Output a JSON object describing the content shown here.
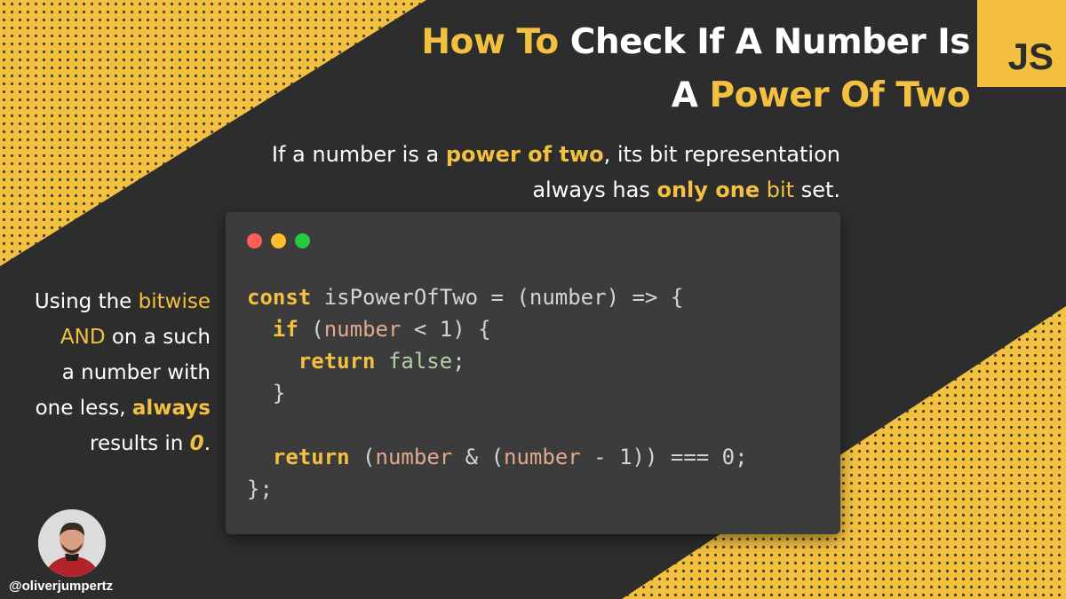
{
  "title": {
    "line1_part1": "How To",
    "line1_part2": " Check If A Number Is",
    "line2_part1": "A ",
    "line2_part2": "Power Of Two"
  },
  "badge": {
    "label": "JS"
  },
  "subtitle": {
    "p1": "If a number is a ",
    "p2": "power of two",
    "p3": ", its bit representation",
    "p4": "always has ",
    "p5": "only one",
    "p6": " ",
    "p7": "bit",
    "p8": " set."
  },
  "side_note": {
    "s1": "Using the ",
    "s2": "bitwise",
    "s3": "AND",
    "s4": " on a such",
    "s5": "a number with",
    "s6": "one less, ",
    "s7": "always",
    "s8": "results in ",
    "s9": "0",
    "s10": "."
  },
  "code": {
    "l1_kw": "const",
    "l1_rest": " isPowerOfTwo = (number) => {",
    "l2_kw": "if",
    "l2_open": " (",
    "l2_param": "number",
    "l2_rest": " < 1) {",
    "l3_kw": "return",
    "l3_val": " false",
    "l3_end": ";",
    "l4": "}",
    "l6_kw": "return",
    "l6_a": " (",
    "l6_p1": "number",
    "l6_b": " & (",
    "l6_p2": "number",
    "l6_c": " - 1)) === 0;",
    "l7": "};"
  },
  "author": {
    "handle": "@oliverjumpertz"
  },
  "colors": {
    "accent": "#f3c03f",
    "background": "#2d2d2d",
    "code_bg": "#3c3c3c"
  }
}
